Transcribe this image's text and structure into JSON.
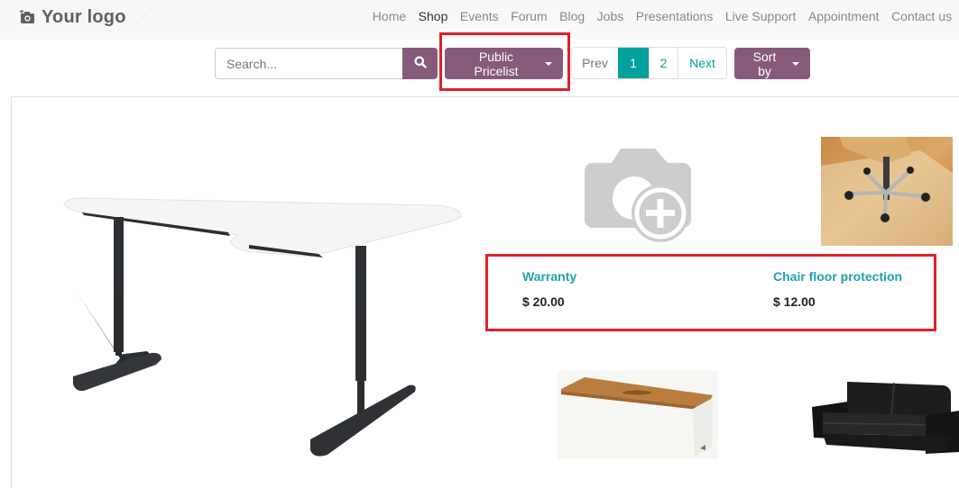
{
  "header": {
    "logo_text": "Your logo",
    "nav": [
      {
        "label": "Home",
        "active": false
      },
      {
        "label": "Shop",
        "active": true
      },
      {
        "label": "Events",
        "active": false
      },
      {
        "label": "Forum",
        "active": false
      },
      {
        "label": "Blog",
        "active": false
      },
      {
        "label": "Jobs",
        "active": false
      },
      {
        "label": "Presentations",
        "active": false
      },
      {
        "label": "Live Support",
        "active": false
      },
      {
        "label": "Appointment",
        "active": false
      },
      {
        "label": "Contact us",
        "active": false
      }
    ]
  },
  "toolbar": {
    "search_placeholder": "Search...",
    "search_value": "",
    "pricelist_label": "Public Pricelist",
    "pager": {
      "prev": "Prev",
      "pages": [
        "1",
        "2"
      ],
      "current": "1",
      "next": "Next"
    },
    "sort_label": "Sort by"
  },
  "products": [
    {
      "name": "",
      "price": "",
      "image": "corner-desk-image"
    },
    {
      "name": "Warranty",
      "price": "$ 20.00",
      "image": "placeholder-camera-image"
    },
    {
      "name": "Chair floor protection",
      "price": "$ 12.00",
      "image": "chair-floor-mat-image"
    },
    {
      "name": "",
      "price": "",
      "image": "cable-management-box-image"
    },
    {
      "name": "",
      "price": "",
      "image": "black-sofa-image"
    }
  ],
  "colors": {
    "primary": "#875a7b",
    "accent": "#00a09d",
    "link": "#1fa2a9",
    "annotation": "#e0202a",
    "header_bg": "#f8f8f8"
  }
}
